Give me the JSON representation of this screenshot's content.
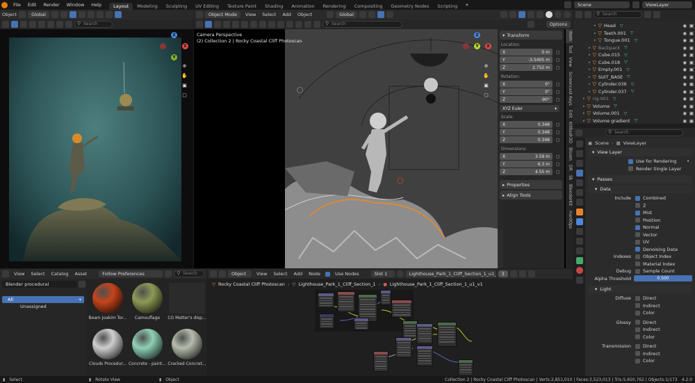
{
  "topbar": {
    "menus": [
      "File",
      "Edit",
      "Render",
      "Window",
      "Help"
    ],
    "workspaces": [
      "Layout",
      "Modeling",
      "Sculpting",
      "UV Editing",
      "Texture Paint",
      "Shading",
      "Animation",
      "Rendering",
      "Compositing",
      "Geometry Nodes",
      "Scripting"
    ],
    "active_workspace": "Layout",
    "add_tab_label": "+",
    "scene_label": "Scene",
    "viewlayer_label": "ViewLayer"
  },
  "left_viewport": {
    "mode_label": "Object",
    "orientation": "Global",
    "search_placeholder": "Search",
    "gizmo_axes": {
      "z": "Z",
      "x": "X",
      "y": "Y"
    }
  },
  "main_viewport": {
    "mode_label": "Object Mode",
    "menus": [
      "View",
      "Select",
      "Add",
      "Object"
    ],
    "orientation": "Global",
    "options_label": "Options",
    "search_placeholder": "Search",
    "overlay_title": "Camera Perspective",
    "overlay_subtitle": "(2) Collection 2 | Rocky Coastal Cliff Photoscan",
    "gizmo_axes": {
      "z": "Z",
      "x": "X",
      "y": "Y"
    }
  },
  "n_panel": {
    "transform_header": "Transform",
    "location_label": "Location:",
    "location": [
      {
        "axis": "X",
        "value": "0 m"
      },
      {
        "axis": "Y",
        "value": "-3.5405 m"
      },
      {
        "axis": "Z",
        "value": "2.752 m"
      }
    ],
    "rotation_label": "Rotation:",
    "rotation": [
      {
        "axis": "X",
        "value": "0°"
      },
      {
        "axis": "Y",
        "value": "0°"
      },
      {
        "axis": "Z",
        "value": "-90°"
      }
    ],
    "rotation_mode": "XYZ Euler",
    "scale_label": "Scale:",
    "scale": [
      {
        "axis": "X",
        "value": "0.348"
      },
      {
        "axis": "Y",
        "value": "0.348"
      },
      {
        "axis": "Z",
        "value": "0.348"
      }
    ],
    "dimensions_label": "Dimensions:",
    "dimensions": [
      {
        "axis": "X",
        "value": "3.59 m"
      },
      {
        "axis": "Y",
        "value": "6.3 m"
      },
      {
        "axis": "Z",
        "value": "4.55 m"
      }
    ],
    "properties_header": "Properties",
    "align_header": "Align Tools"
  },
  "side_tabs": [
    "Item",
    "Tool",
    "View",
    "Screencast Keys",
    "Edit",
    "KitBash3D",
    "Bloom",
    "DR",
    "Sk",
    "BlenderKit",
    "HardOps"
  ],
  "outliner": {
    "items": [
      {
        "name": "Head",
        "indent": 2
      },
      {
        "name": "Teeth.001",
        "indent": 2
      },
      {
        "name": "Tongue.001",
        "indent": 2
      },
      {
        "name": "Backpack",
        "indent": 1
      },
      {
        "name": "Cube.015",
        "indent": 1
      },
      {
        "name": "Cube.018",
        "indent": 1
      },
      {
        "name": "Empty.001",
        "indent": 1
      },
      {
        "name": "SUIT_BASE",
        "indent": 1
      },
      {
        "name": "Cylinder.036",
        "indent": 1
      },
      {
        "name": "Cylinder.037",
        "indent": 1
      },
      {
        "name": "rig.001",
        "indent": 0
      },
      {
        "name": "Volume",
        "indent": 0
      },
      {
        "name": "Volume.001",
        "indent": 0
      },
      {
        "name": "Volume gradient",
        "indent": 0
      }
    ]
  },
  "properties": {
    "search_placeholder": "Search",
    "breadcrumb_scene": "Scene",
    "breadcrumb_layer": "ViewLayer",
    "view_layer_header": "View Layer",
    "use_for_rendering": "Use for Rendering",
    "render_single_layer": "Render Single Layer",
    "passes_header": "Passes",
    "data_header": "Data",
    "include_label": "Include",
    "data_passes": [
      {
        "label": "Combined",
        "on": true
      },
      {
        "label": "Z",
        "on": false
      },
      {
        "label": "Mist",
        "on": true
      },
      {
        "label": "Position",
        "on": false
      },
      {
        "label": "Normal",
        "on": true
      },
      {
        "label": "Vector",
        "on": false
      },
      {
        "label": "UV",
        "on": false
      },
      {
        "label": "Denoising Data",
        "on": true
      }
    ],
    "indexes_label": "Indexes",
    "index_passes": [
      {
        "label": "Object Index",
        "on": false
      },
      {
        "label": "Material Index",
        "on": false
      }
    ],
    "debug_label": "Debug",
    "sample_count": "Sample Count",
    "alpha_label": "Alpha Threshold",
    "alpha_value": "0.500",
    "light_header": "Light",
    "light_groups": [
      {
        "label": "Diffuse",
        "items": [
          "Direct",
          "Indirect",
          "Color"
        ]
      },
      {
        "label": "Glossy",
        "items": [
          "Direct",
          "Indirect",
          "Color"
        ]
      },
      {
        "label": "Transmission",
        "items": [
          "Direct",
          "Indirect",
          "Color"
        ]
      }
    ]
  },
  "asset_browser": {
    "menus": [
      "View",
      "Select",
      "Catalog",
      "Asset"
    ],
    "follow_label": "Follow Preferences",
    "search_placeholder": "Search",
    "library": "Blender procedural",
    "catalogs": [
      "All",
      "Unassigned"
    ],
    "assets": [
      {
        "name": "Beam Joakim Tor...",
        "color": "#c4451c"
      },
      {
        "name": "Camouflage",
        "color": "#8d9a55"
      },
      {
        "name": "CG Matter's disp...",
        "color": "#2b2b2b"
      },
      {
        "name": "Clouds Procedur...",
        "color": "#cfcfcf"
      },
      {
        "name": "Concrete - paint...",
        "color": "#8fd0b5"
      },
      {
        "name": "Cracked Concret...",
        "color": "#b6bcae"
      }
    ]
  },
  "node_editor": {
    "object_label": "Object",
    "menus": [
      "View",
      "Select",
      "Add",
      "Node"
    ],
    "use_nodes": "Use Nodes",
    "slot": "Slot 1",
    "material": "Lighthouse_Park_1_Cliff_Section_1_u1_v1",
    "users": "3",
    "breadcrumbs": [
      "Rocky Coastal Cliff Photoscan",
      "Lighthouse_Park_1_Cliff_Section_1",
      "Lighthouse_Park_1_Cliff_Section_1_u1_v1"
    ]
  },
  "statusbar": {
    "select": "Select",
    "rotate": "Rotate View",
    "object": "Object",
    "stats": "Collection 2 | Rocky Coastal Cliff Photoscan | Verts:2,851,010 | Faces:3,523,013 | Tris:5,650,762 | Objects:1/173",
    "version": "4.2.0"
  }
}
